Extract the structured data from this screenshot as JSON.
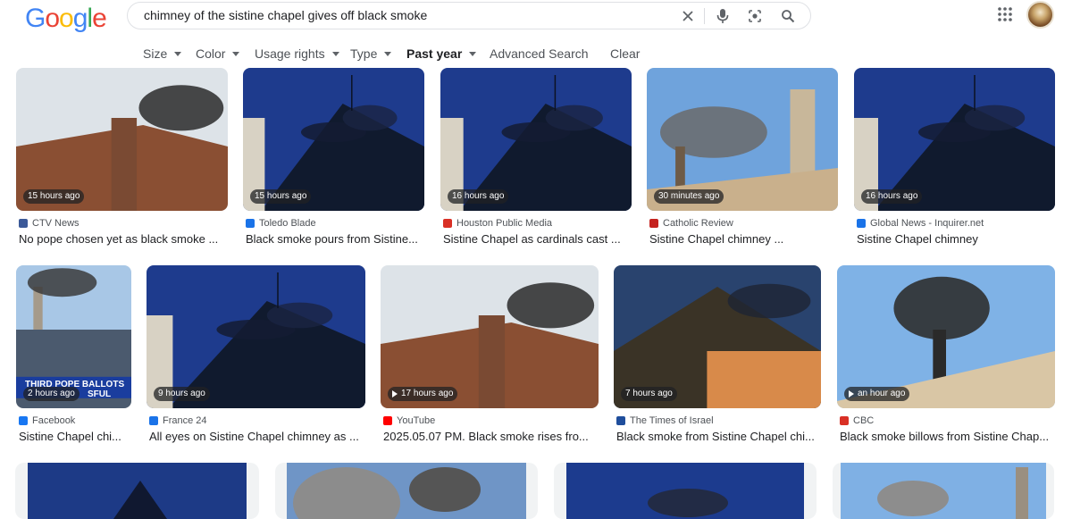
{
  "logo": {
    "letters": [
      "G",
      "o",
      "o",
      "g",
      "l",
      "e"
    ],
    "colors": [
      "#4285F4",
      "#EA4335",
      "#FBBC05",
      "#4285F4",
      "#34A853",
      "#EA4335"
    ]
  },
  "search": {
    "query": "chimney of the sistine chapel gives off black smoke"
  },
  "icons": {
    "clear": "close-icon",
    "voice": "microphone-icon",
    "lens": "camera-lens-icon",
    "search": "search-icon",
    "apps": "apps-grid-icon"
  },
  "filters": [
    {
      "label": "Size",
      "dropdown": true
    },
    {
      "label": "Color",
      "dropdown": true
    },
    {
      "label": "Usage rights",
      "dropdown": true
    },
    {
      "label": "Type",
      "dropdown": true
    },
    {
      "label": "Past year",
      "dropdown": true,
      "active": true
    },
    {
      "label": "Advanced Search",
      "dropdown": false
    },
    {
      "label": "Clear",
      "dropdown": false
    }
  ],
  "results": [
    {
      "time": "15 hours ago",
      "source": "CTV News",
      "title": "No pope chosen yet as black smoke ...",
      "video": false,
      "fav": "#3b5998",
      "scene": "roof-sky"
    },
    {
      "time": "15 hours ago",
      "source": "Toledo Blade",
      "title": "Black smoke pours from Sistine...",
      "video": false,
      "fav": "#1a73e8",
      "scene": "night"
    },
    {
      "time": "16 hours ago",
      "source": "Houston Public Media",
      "title": "Sistine Chapel as cardinals cast ...",
      "video": false,
      "fav": "#d93025",
      "scene": "night"
    },
    {
      "time": "30 minutes ago",
      "source": "Catholic Review",
      "title": "Sistine Chapel chimney ...",
      "video": false,
      "fav": "#c5221f",
      "scene": "day"
    },
    {
      "time": "16 hours ago",
      "source": "Global News - Inquirer.net",
      "title": "Sistine Chapel chimney",
      "video": false,
      "fav": "#1a73e8",
      "scene": "night"
    },
    {
      "time": "2 hours ago",
      "source": "Facebook",
      "title": "Sistine Chapel chi...",
      "video": false,
      "fav": "#1877f2",
      "scene": "tv",
      "overlay": "THIRD POPE BALLOTS",
      "overlay2": "SFUL"
    },
    {
      "time": "9 hours ago",
      "source": "France 24",
      "title": "All eyes on Sistine Chapel chimney as ...",
      "video": false,
      "fav": "#1a73e8",
      "scene": "night"
    },
    {
      "time": "17 hours ago",
      "source": "YouTube",
      "title": "2025.05.07 PM. Black smoke rises fro...",
      "video": true,
      "fav": "#ff0000",
      "scene": "roof-sky"
    },
    {
      "time": "7 hours ago",
      "source": "The Times of Israel",
      "title": "Black smoke from Sistine Chapel chi...",
      "video": false,
      "fav": "#1f4e9c",
      "scene": "dusk"
    },
    {
      "time": "an hour ago",
      "source": "CBC",
      "title": "Black smoke billows from Sistine Chap...",
      "video": true,
      "fav": "#d93025",
      "scene": "day-roof"
    }
  ]
}
